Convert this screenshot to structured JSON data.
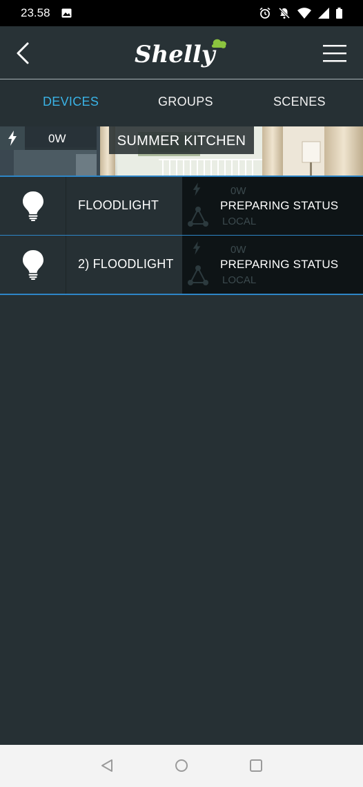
{
  "status_bar": {
    "time": "23.58"
  },
  "app": {
    "logo_text": "Shelly"
  },
  "tabs": [
    {
      "label": "DEVICES"
    },
    {
      "label": "GROUPS"
    },
    {
      "label": "SCENES"
    }
  ],
  "room": {
    "power": "0W",
    "title": "SUMMER KITCHEN"
  },
  "devices": [
    {
      "name": "FLOODLIGHT",
      "status": "PREPARING STATUS",
      "power": "0W",
      "connection": "LOCAL"
    },
    {
      "name": "2) FLOODLIGHT",
      "status": "PREPARING STATUS",
      "power": "0W",
      "connection": "LOCAL"
    }
  ],
  "colors": {
    "accent": "#3ab3e6",
    "background": "#263034",
    "divider": "#2e86c8"
  }
}
